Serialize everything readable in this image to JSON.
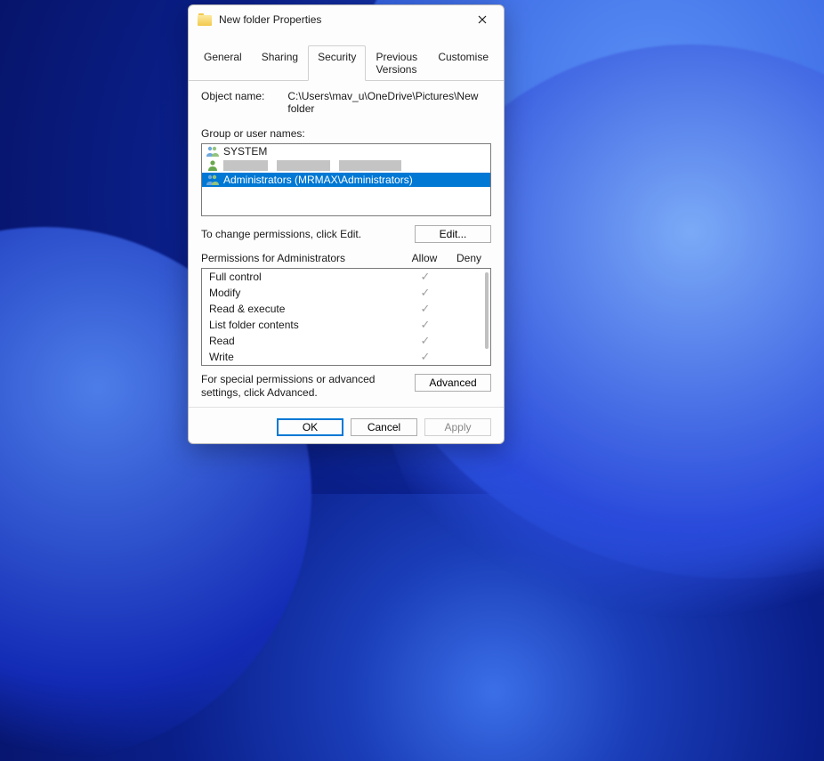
{
  "dialog": {
    "title": "New folder Properties",
    "tabs": [
      "General",
      "Sharing",
      "Security",
      "Previous Versions",
      "Customise"
    ],
    "active_tab": "Security",
    "object_name_label": "Object name:",
    "object_name_value": "C:\\Users\\mav_u\\OneDrive\\Pictures\\New folder",
    "group_label": "Group or user names:",
    "principals": [
      {
        "name": "SYSTEM",
        "icon": "group",
        "selected": false,
        "redacted": false
      },
      {
        "name": "",
        "icon": "user",
        "selected": false,
        "redacted": true
      },
      {
        "name": "Administrators (MRMAX\\Administrators)",
        "icon": "group",
        "selected": true,
        "redacted": false
      }
    ],
    "edit_hint": "To change permissions, click Edit.",
    "edit_button": "Edit...",
    "permissions_label": "Permissions for Administrators",
    "perm_columns": {
      "allow": "Allow",
      "deny": "Deny"
    },
    "permissions": [
      {
        "name": "Full control",
        "allow": true,
        "deny": false
      },
      {
        "name": "Modify",
        "allow": true,
        "deny": false
      },
      {
        "name": "Read & execute",
        "allow": true,
        "deny": false
      },
      {
        "name": "List folder contents",
        "allow": true,
        "deny": false
      },
      {
        "name": "Read",
        "allow": true,
        "deny": false
      },
      {
        "name": "Write",
        "allow": true,
        "deny": false
      }
    ],
    "advanced_text": "For special permissions or advanced settings, click Advanced.",
    "advanced_button": "Advanced",
    "footer": {
      "ok": "OK",
      "cancel": "Cancel",
      "apply": "Apply"
    }
  }
}
